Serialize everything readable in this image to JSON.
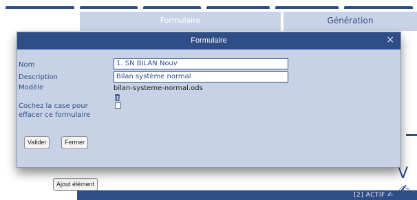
{
  "background": {
    "tabs": [
      "Formulaire",
      "Génération"
    ],
    "add_element_button": "Ajout élément",
    "bottom_bar_text": "[2] ACTIF ✍︎",
    "right_glyph": "V✍︎"
  },
  "dialog": {
    "title": "Formulaire",
    "close_icon": "×",
    "fields": {
      "nom_label": "Nom",
      "nom_value": "1. SN BILAN Nouv",
      "description_label": "Description",
      "description_value": "Bilan système normal",
      "modele_label": "Modèle",
      "modele_value": "bilan-systeme-normal.ods",
      "checkbox_label": "Cochez la case pour effacer ce formulaire"
    },
    "buttons": {
      "valider": "Valider",
      "fermer": "Fermer"
    }
  },
  "colors": {
    "primary": "#2f4d86",
    "dialog_bg": "#c8d2e6",
    "tab_bg": "#c9d3e8"
  }
}
